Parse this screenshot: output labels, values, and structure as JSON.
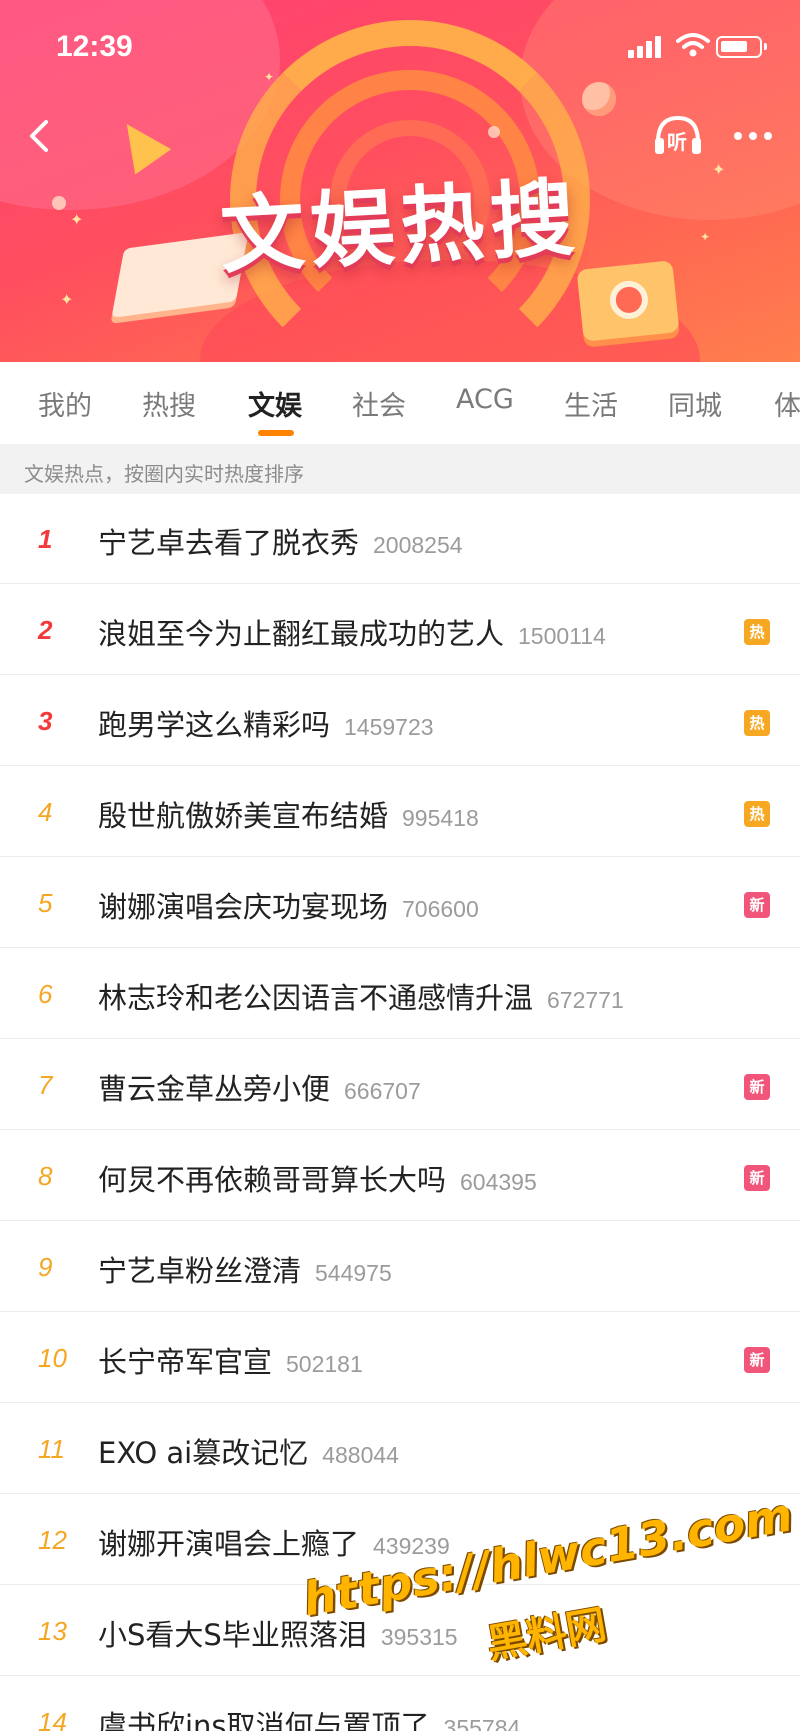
{
  "status_bar": {
    "time": "12:39"
  },
  "banner": {
    "title": "文娱热搜",
    "listen_label": "听"
  },
  "tabs": [
    {
      "label": "我的",
      "active": false
    },
    {
      "label": "热搜",
      "active": false
    },
    {
      "label": "文娱",
      "active": true
    },
    {
      "label": "社会",
      "active": false
    },
    {
      "label": "ACG",
      "active": false
    },
    {
      "label": "生活",
      "active": false
    },
    {
      "label": "同城",
      "active": false
    },
    {
      "label": "体",
      "active": false
    }
  ],
  "subtitle": "文娱热点，按圈内实时热度排序",
  "colors": {
    "accent": "#ff8200",
    "rank_top": "#f4393b",
    "rank_other": "#f5a623",
    "badge_hot": "#f7a823",
    "badge_new": "#f2557a"
  },
  "list": [
    {
      "rank": "1",
      "title": "宁艺卓去看了脱衣秀",
      "count": "2008254",
      "badge": ""
    },
    {
      "rank": "2",
      "title": "浪姐至今为止翻红最成功的艺人",
      "count": "1500114",
      "badge": "热"
    },
    {
      "rank": "3",
      "title": "跑男学这么精彩吗",
      "count": "1459723",
      "badge": "热"
    },
    {
      "rank": "4",
      "title": "殷世航傲娇美宣布结婚",
      "count": "995418",
      "badge": "热"
    },
    {
      "rank": "5",
      "title": "谢娜演唱会庆功宴现场",
      "count": "706600",
      "badge": "新"
    },
    {
      "rank": "6",
      "title": "林志玲和老公因语言不通感情升温",
      "count": "672771",
      "badge": ""
    },
    {
      "rank": "7",
      "title": "曹云金草丛旁小便",
      "count": "666707",
      "badge": "新"
    },
    {
      "rank": "8",
      "title": "何炅不再依赖哥哥算长大吗",
      "count": "604395",
      "badge": "新"
    },
    {
      "rank": "9",
      "title": "宁艺卓粉丝澄清",
      "count": "544975",
      "badge": ""
    },
    {
      "rank": "10",
      "title": "长宁帝军官宣",
      "count": "502181",
      "badge": "新"
    },
    {
      "rank": "11",
      "title": "EXO ai篡改记忆",
      "count": "488044",
      "badge": ""
    },
    {
      "rank": "12",
      "title": "谢娜开演唱会上瘾了",
      "count": "439239",
      "badge": ""
    },
    {
      "rank": "13",
      "title": "小S看大S毕业照落泪",
      "count": "395315",
      "badge": ""
    },
    {
      "rank": "14",
      "title": "虞书欣ins取消何与置顶了",
      "count": "355784",
      "badge": ""
    }
  ],
  "watermark": {
    "line1": "https://hlwc13.com",
    "line2": "黑料网"
  }
}
